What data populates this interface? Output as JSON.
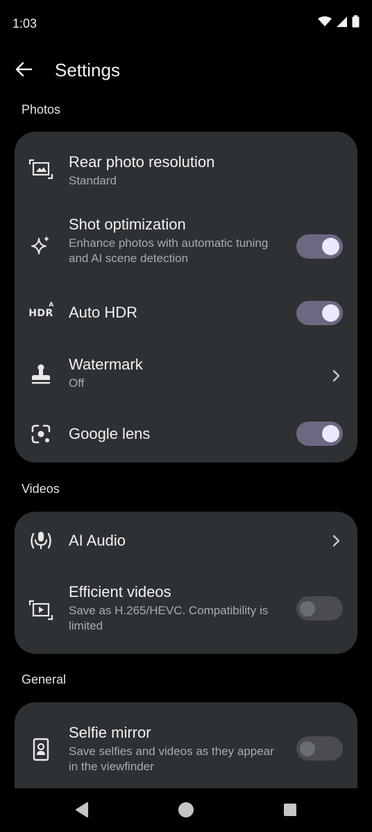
{
  "status_bar": {
    "time": "1:03",
    "icons": [
      "wifi-icon",
      "signal-icon",
      "battery-icon"
    ]
  },
  "app_bar": {
    "back_icon": "arrow-left-icon",
    "title": "Settings"
  },
  "sections": {
    "photos": {
      "header": "Photos",
      "rear_resolution": {
        "title": "Rear photo resolution",
        "subtitle": "Standard",
        "icon": "image-frame-icon"
      },
      "shot_optimization": {
        "title": "Shot optimization",
        "subtitle": "Enhance photos with automatic tuning and AI scene detection",
        "icon": "sparkle-icon",
        "enabled": true
      },
      "auto_hdr": {
        "title": "Auto HDR",
        "icon": "hdr-auto-icon",
        "icon_text": "HDR",
        "icon_sup": "A",
        "enabled": true
      },
      "watermark": {
        "title": "Watermark",
        "subtitle": "Off",
        "icon": "stamp-icon"
      },
      "google_lens": {
        "title": "Google lens",
        "icon": "lens-icon",
        "enabled": true
      }
    },
    "videos": {
      "header": "Videos",
      "ai_audio": {
        "title": "AI Audio",
        "icon": "mic-waves-icon"
      },
      "efficient_videos": {
        "title": "Efficient videos",
        "subtitle": "Save as H.265/HEVC. Compatibility is limited",
        "icon": "video-frame-icon",
        "enabled": false
      }
    },
    "general": {
      "header": "General",
      "selfie_mirror": {
        "title": "Selfie mirror",
        "subtitle": "Save selfies and videos as they appear in the viewfinder",
        "icon": "portrait-icon",
        "enabled": false
      }
    }
  },
  "nav_bar": {
    "buttons": [
      "back-triangle-icon",
      "home-circle-icon",
      "recents-square-icon"
    ]
  },
  "colors": {
    "background": "#000000",
    "card": "#2e3133",
    "toggle_on_track": "#6d6882",
    "toggle_on_knob": "#ece7ff",
    "toggle_off_track": "#4a4c50",
    "subtitle": "#a8abb0"
  }
}
